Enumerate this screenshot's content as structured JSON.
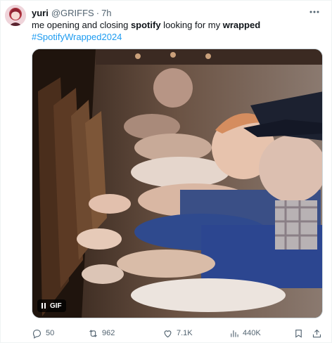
{
  "post": {
    "author_name": "yuri",
    "author_handle": "@GRIFFS",
    "separator": "·",
    "time": "7h",
    "text_parts": {
      "pre": "me opening and closing ",
      "bold1": "spotify",
      "mid": " looking for my ",
      "bold2": "wrapped"
    },
    "hashtag": "#SpotifyWrapped2024",
    "media_badge": "GIF"
  },
  "actions": {
    "replies": "50",
    "reposts": "962",
    "likes": "7.1K",
    "views": "440K"
  },
  "icons": [
    "avatar",
    "more-icon",
    "pause-icon",
    "reply-icon",
    "repost-icon",
    "like-icon",
    "views-icon",
    "bookmark-icon",
    "share-icon"
  ],
  "colors": {
    "link": "#1d9bf0",
    "muted": "#536471",
    "text": "#0f1419"
  }
}
